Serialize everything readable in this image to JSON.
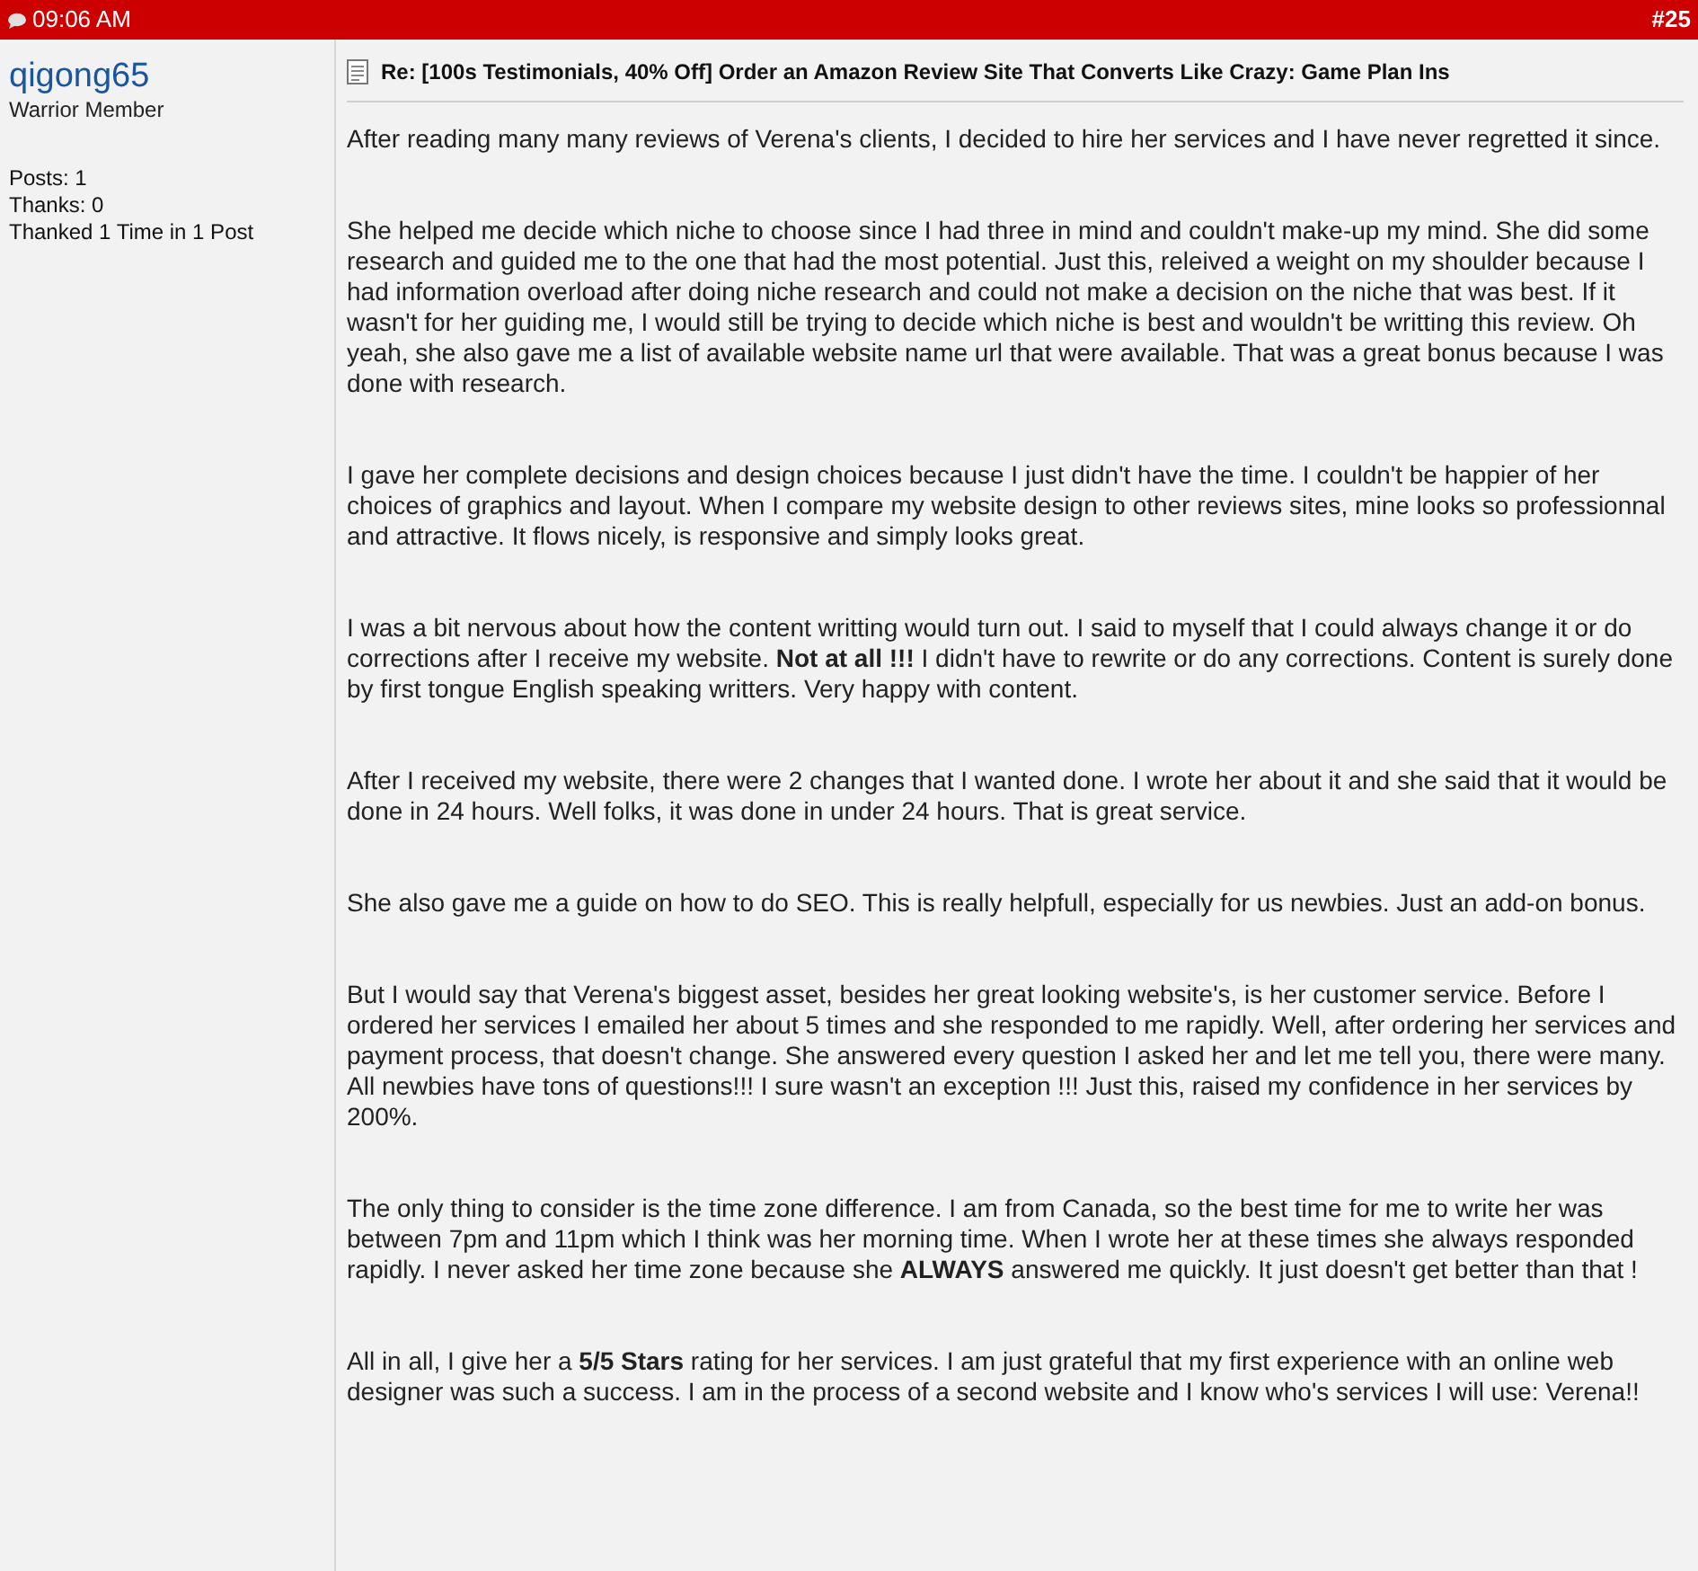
{
  "header": {
    "time": "09:06 AM",
    "post_number": "#25"
  },
  "user": {
    "name": "qigong65",
    "rank": "Warrior Member",
    "stats": [
      "Posts: 1",
      "Thanks: 0",
      "Thanked 1 Time in 1 Post"
    ]
  },
  "post": {
    "title": "Re: [100s Testimonials, 40% Off] Order an Amazon Review Site That Converts Like Crazy: Game Plan Ins",
    "paragraphs": [
      "After reading many many reviews of Verena's clients, I decided to hire her services and I have never regretted it since.",
      "She helped me decide which niche to choose since I had three in mind and couldn't make-up my mind. She did some research and guided me to the one that had the most potential. Just this, releived a weight on my shoulder because I had information overload after doing niche research and could not make a decision on the niche that was best. If it wasn't for her guiding me, I would still be trying to decide which niche is best and wouldn't be writting this review. Oh yeah, she also gave me a list of available website name url that were available. That was a great bonus because I was done with research.",
      "I gave her complete decisions and design choices because I just didn't have the time. I couldn't be happier of her choices of graphics and layout. When I compare my website design to other reviews sites, mine looks so professionnal and attractive. It flows nicely, is responsive and simply looks great.",
      "I was a bit nervous about how the content writting would turn out. I said to myself that I could always change it or do corrections after I receive my website. **Not at all !!!** I didn't have to rewrite or do any corrections. Content is surely done by first tongue English speaking writters. Very happy with content.",
      "After I received my website, there were 2 changes that I wanted done. I wrote her about it and she said that it would be done in 24 hours. Well folks, it was done in under 24 hours. That is great service.",
      "She also gave me a guide on how to do SEO. This is really helpfull, especially for us newbies. Just an add-on bonus.",
      "But I would say that Verena's biggest asset, besides her great looking website's, is her customer service. Before I ordered her services I emailed her about 5 times and she responded to me rapidly. Well, after ordering her services and payment process, that doesn't change. She answered every question I asked her and let me tell you, there were many. All newbies have tons of questions!!! I sure wasn't an exception !!! Just this, raised my confidence in her services by 200%.",
      "The only thing to consider is the time zone difference. I am from Canada, so the best time for me to write her was between 7pm and 11pm which I think was her morning time. When I wrote her at these times she always responded rapidly. I never asked her time zone because she **ALWAYS** answered me quickly. It just doesn't get better than that !",
      "All in all, I give her a **5/5 Stars** rating for her services. I am just grateful that my first experience with an online web designer was such a success. I am in the process of a second website and I know who's services I will use: Verena!!"
    ]
  }
}
